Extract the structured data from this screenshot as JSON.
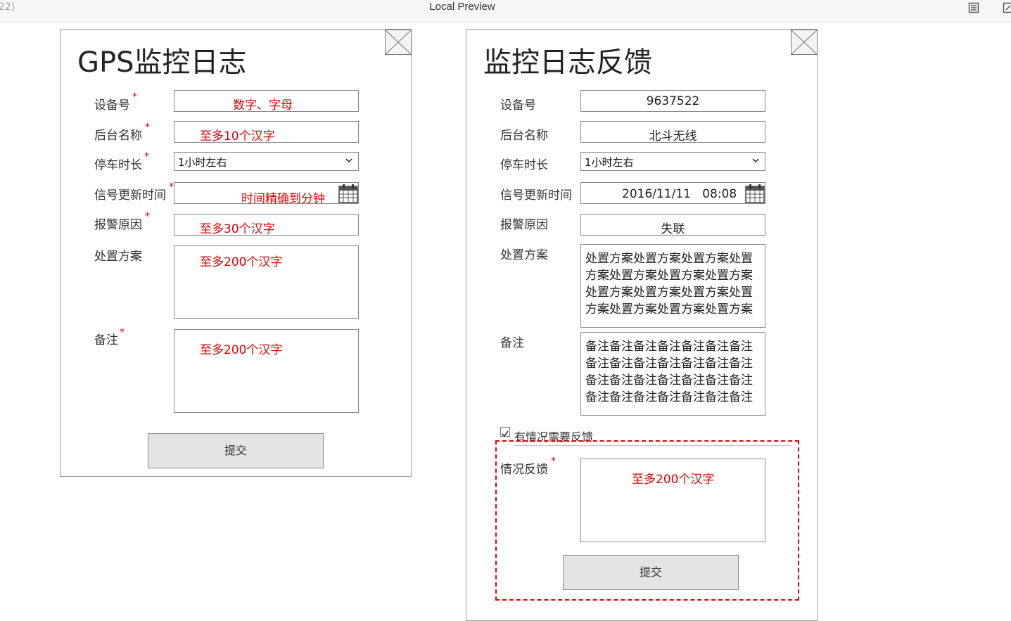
{
  "window": {
    "left_fragment": "22)",
    "title": "Local Preview"
  },
  "left_panel": {
    "title": "GPS监控日志",
    "fields": {
      "device_no": {
        "label": "设备号",
        "placeholder": "数字、字母"
      },
      "backend_name": {
        "label": "后台名称",
        "placeholder": "至多10个汉字"
      },
      "parking_duration": {
        "label": "停车时长",
        "selected": "1小时左右"
      },
      "signal_update_time": {
        "label": "信号更新时间",
        "placeholder": "时间精确到分钟"
      },
      "alarm_reason": {
        "label": "报警原因",
        "placeholder": "至多30个汉字"
      },
      "disposal_plan": {
        "label": "处置方案",
        "placeholder": "至多200个汉字"
      },
      "remarks": {
        "label": "备注",
        "placeholder": "至多200个汉字"
      }
    },
    "required_mark": "*",
    "submit_label": "提交"
  },
  "right_panel": {
    "title": "监控日志反馈",
    "fields": {
      "device_no": {
        "label": "设备号",
        "value": "9637522"
      },
      "backend_name": {
        "label": "后台名称",
        "value": "北斗无线"
      },
      "parking_duration": {
        "label": "停车时长",
        "selected": "1小时左右"
      },
      "signal_update_time": {
        "label": "信号更新时间",
        "value": "2016/11/11   08:08"
      },
      "alarm_reason": {
        "label": "报警原因",
        "value": "失联"
      },
      "disposal_plan": {
        "label": "处置方案",
        "value": "处置方案处置方案处置方案处置方案处置方案处置方案处置方案处置方案处置方案处置方案处置方案处置方案处置方案处置方案"
      },
      "remarks": {
        "label": "备注",
        "value": "备注备注备注备注备注备注备注备注备注备注备注备注备注备注备注备注备注备注备注备注备注备注备注备注备注备注备注备注"
      }
    },
    "feedback_checkbox": {
      "label": "有情况需要反馈",
      "checked": true
    },
    "feedback": {
      "label": "情况反馈",
      "placeholder": "至多200个汉字"
    },
    "required_mark": "*",
    "submit_label": "提交"
  }
}
